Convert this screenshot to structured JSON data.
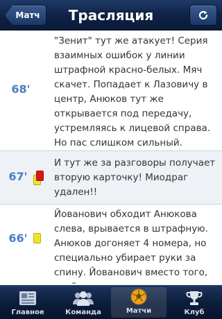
{
  "navbar": {
    "back_label": "Матч",
    "title": "Трасляция",
    "refresh_icon": "refresh-icon"
  },
  "feed": {
    "events": [
      {
        "minute": "68'",
        "cards": [],
        "text": "\"Зенит\" тут же атакует! Серия взаимных ошибок у линии штрафной красно-белых. Мяч скачет. Попадает к Лазовичу в центр, Анюков тут же открывается под передачу, устремляясь к лицевой справа. Но пас слишком сильный."
      },
      {
        "minute": "67'",
        "cards": [
          "yellow",
          "red"
        ],
        "text": "И тут же за разговоры получает вторую карточку! Миодраг удален!!"
      },
      {
        "minute": "66'",
        "cards": [
          "yellow"
        ],
        "text": "Йованович обходит Анюкова слева, врывается в штрафную. Анюков догоняет 4 номера, но специально убирает руки за спину. Йованович вместо того, чтобы прострелить, валит"
      }
    ]
  },
  "tabbar": {
    "tabs": [
      {
        "label": "Главное",
        "icon": "newspaper-icon",
        "active": false
      },
      {
        "label": "Команда",
        "icon": "team-icon",
        "active": false
      },
      {
        "label": "Матчи",
        "icon": "ball-icon",
        "active": true
      },
      {
        "label": "Клуб",
        "icon": "trophy-icon",
        "active": false
      }
    ]
  },
  "colors": {
    "navbar": "#0f2347",
    "minute": "#4a7fc1",
    "card_yellow": "#f2e326",
    "card_red": "#d9151b",
    "alt_row": "#eef2f7"
  }
}
